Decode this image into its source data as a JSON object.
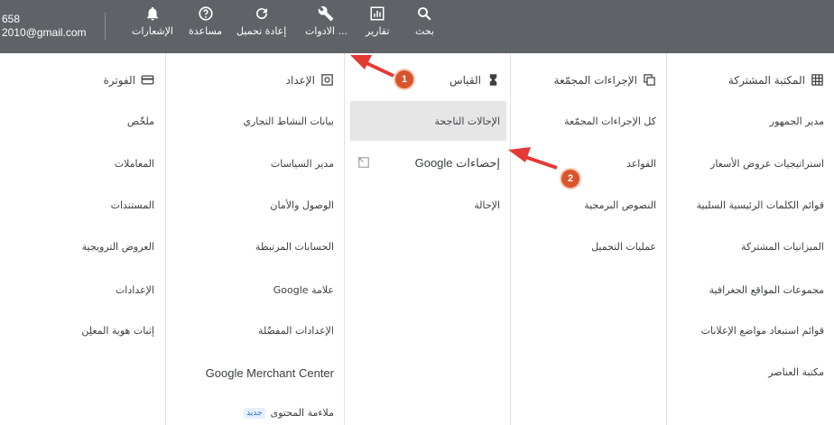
{
  "account": {
    "line1": "658",
    "line2": "2010@gmail.com"
  },
  "toolbar": [
    {
      "label": "الإشعارات",
      "icon": "bell-icon"
    },
    {
      "label": "مساعدة",
      "icon": "help-icon"
    },
    {
      "label": "إعادة تحميل",
      "icon": "refresh-icon"
    },
    {
      "label": "الادوات ...",
      "icon": "wrench-icon"
    },
    {
      "label": "تقارير",
      "icon": "reports-icon"
    },
    {
      "label": "بحث",
      "icon": "search-icon"
    }
  ],
  "columns": {
    "shared_library": {
      "title": "المكتبة المشتركة",
      "icon": "library-icon",
      "items": [
        "مدير الجمهور",
        "استراتيجيات عروض الأسعار",
        "قوائم الكلمات الرئيسية السلبية",
        "الميزانيات المشتركة",
        "مجموعات المواقع الجغرافية",
        "قوائم استبعاد مواضع الإعلانات",
        "مكتبة العناصر"
      ]
    },
    "bulk_actions": {
      "title": "الإجراءات المجمّعة",
      "icon": "bulk-actions-icon",
      "items": [
        "كل الإجراءات المجمّعة",
        "القواعد",
        "النصوص البرمجية",
        "عمليات التحميل"
      ]
    },
    "measurement": {
      "title": "القياس",
      "icon": "hourglass-icon",
      "items": [
        "الإحالات الناجحة",
        "إحصاءات Google",
        "الإحالة"
      ]
    },
    "setup": {
      "title": "الإعداد",
      "icon": "setup-icon",
      "items": [
        "بيانات النشاط التجاري",
        "مدير السياسات",
        "الوصول والأمان",
        "الحسابات المرتبطة",
        "علامة Google",
        "الإعدادات المفضّلة",
        "Google Merchant Center",
        "ملاءمة المحتوى"
      ],
      "new_badge": "جديد"
    },
    "billing": {
      "title": "الفوترة",
      "icon": "billing-icon",
      "items": [
        "ملخّص",
        "المعاملات",
        "المستندات",
        "العروض الترويجية",
        "الإعدادات",
        "إثبات هوية المعلِن"
      ]
    }
  },
  "annotations": {
    "marker1": "1",
    "marker2": "2",
    "color": "#d9542c"
  }
}
